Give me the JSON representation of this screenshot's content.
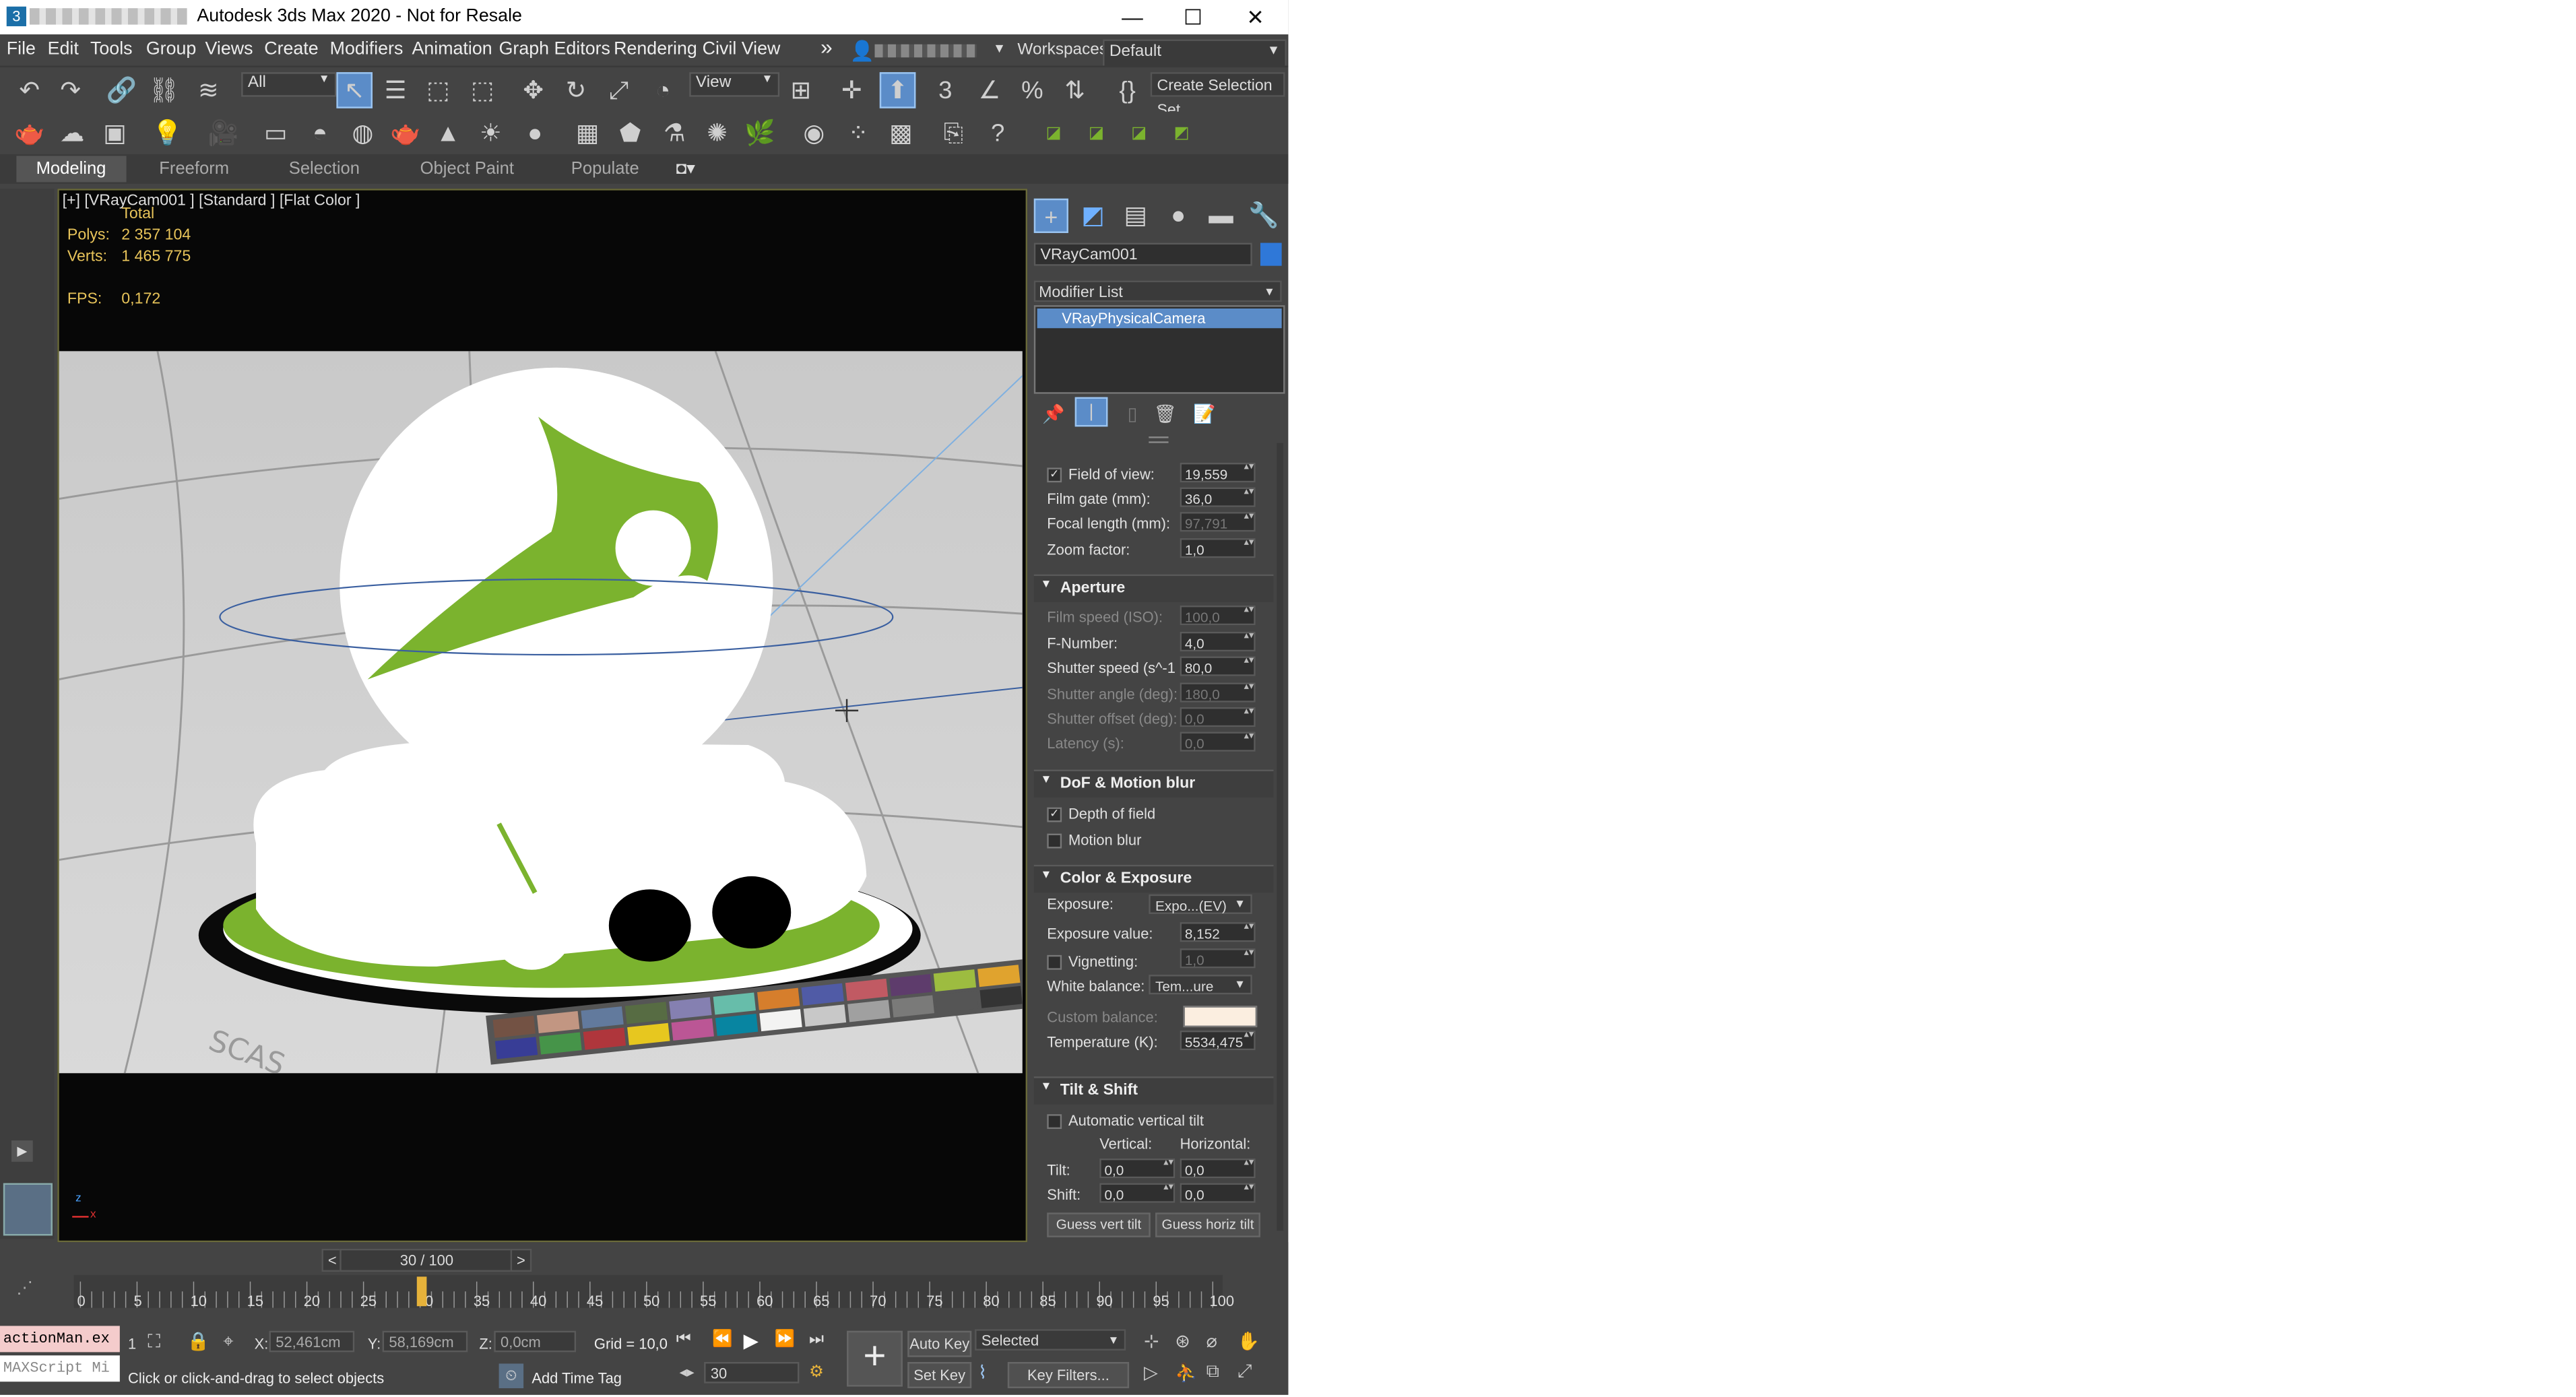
{
  "window": {
    "title": "Autodesk 3ds Max 2020 - Not for Resale",
    "logo_glyph": "3",
    "minimize": "—",
    "maximize": "☐",
    "close": "✕"
  },
  "menubar": {
    "items": [
      "File",
      "Edit",
      "Tools",
      "Group",
      "Views",
      "Create",
      "Modifiers",
      "Animation",
      "Graph Editors",
      "Rendering",
      "Civil View"
    ],
    "overflow": "»",
    "workspaces_label": "Workspaces:",
    "workspace_value": "Default"
  },
  "toolbar": {
    "filter_value": "All",
    "view_value": "View",
    "create_selection_set": "Create Selection Set"
  },
  "ribbon": {
    "tabs": [
      "Modeling",
      "Freeform",
      "Selection",
      "Object Paint",
      "Populate"
    ]
  },
  "viewport": {
    "label": "[+] [VRayCam001 ] [Standard ] [Flat Color ]",
    "stats_total": "Total",
    "polys_label": "Polys:",
    "polys_value": "2 357 104",
    "verts_label": "Verts:",
    "verts_value": "1 465 775",
    "fps_label": "FPS:",
    "fps_value": "0,172",
    "axis_z": "z",
    "axis_x": "x"
  },
  "command_panel": {
    "object_name": "VRayCam001",
    "modifier_list": "Modifier List",
    "stack_item": "VRayPhysicalCamera",
    "params": [
      {
        "label": "Field of view:",
        "value": "19,559",
        "checked": true,
        "disabled": false
      },
      {
        "label": "Film gate (mm):",
        "value": "36,0",
        "disabled": false
      },
      {
        "label": "Focal length (mm):",
        "value": "97,791",
        "disabled": true
      },
      {
        "label": "Zoom factor:",
        "value": "1,0",
        "disabled": false
      }
    ],
    "aperture": {
      "title": "Aperture",
      "rows": [
        {
          "label": "Film speed (ISO):",
          "value": "100,0",
          "disabled": true
        },
        {
          "label": "F-Number:",
          "value": "4,0",
          "disabled": false
        },
        {
          "label": "Shutter speed (s^-1",
          "value": "80,0",
          "disabled": false
        },
        {
          "label": "Shutter angle (deg):",
          "value": "180,0",
          "disabled": true
        },
        {
          "label": "Shutter offset (deg):",
          "value": "0,0",
          "disabled": true
        },
        {
          "label": "Latency (s):",
          "value": "0,0",
          "disabled": true
        }
      ]
    },
    "dof": {
      "title": "DoF & Motion blur",
      "depth_of_field": "Depth of field",
      "motion_blur": "Motion blur"
    },
    "color_exposure": {
      "title": "Color & Exposure",
      "exposure_label": "Exposure:",
      "exposure_value": "Expo...(EV)",
      "exposure_value_label": "Exposure value:",
      "exposure_value_num": "8,152",
      "vignetting_label": "Vignetting:",
      "vignetting_value": "1,0",
      "white_balance_label": "White balance:",
      "white_balance_value": "Tem...ure",
      "custom_balance_label": "Custom balance:",
      "temperature_label": "Temperature (K):",
      "temperature_value": "5534,475"
    },
    "tilt_shift": {
      "title": "Tilt & Shift",
      "auto_vertical": "Automatic vertical tilt",
      "vertical": "Vertical:",
      "horizontal": "Horizontal:",
      "tilt_label": "Tilt:",
      "shift_label": "Shift:",
      "tilt_v": "0,0",
      "tilt_h": "0,0",
      "shift_v": "0,0",
      "shift_h": "0,0",
      "guess_vert": "Guess vert tilt",
      "guess_horiz": "Guess horiz tilt"
    }
  },
  "timeline": {
    "frame_display": "30 / 100",
    "prev": "<",
    "next": ">",
    "ticks": [
      "0",
      "5",
      "10",
      "15",
      "20",
      "25",
      "30",
      "35",
      "40",
      "45",
      "50",
      "55",
      "60",
      "65",
      "70",
      "75",
      "80",
      "85",
      "90",
      "95",
      "100"
    ],
    "current_frame": 30,
    "total_frames": 100
  },
  "statusbar": {
    "script_line1": "actionMan.ex",
    "script_line2": "MAXScript Mi",
    "selected_count": "1",
    "x_label": "X:",
    "x_value": "52,461cm",
    "y_label": "Y:",
    "y_value": "58,169cm",
    "z_label": "Z:",
    "z_value": "0,0cm",
    "grid": "Grid = 10,0",
    "prompt": "Click or click-and-drag to select objects",
    "add_time_tag": "Add Time Tag",
    "auto_key": "Auto Key",
    "set_key": "Set Key",
    "selected_dd": "Selected",
    "key_filters": "Key Filters...",
    "frame_field": "30"
  },
  "colors": {
    "accent": "#5b8cc8",
    "stat_yellow": "#e8c45a",
    "green": "#7bb32e",
    "viewport_bg": "#070707"
  }
}
